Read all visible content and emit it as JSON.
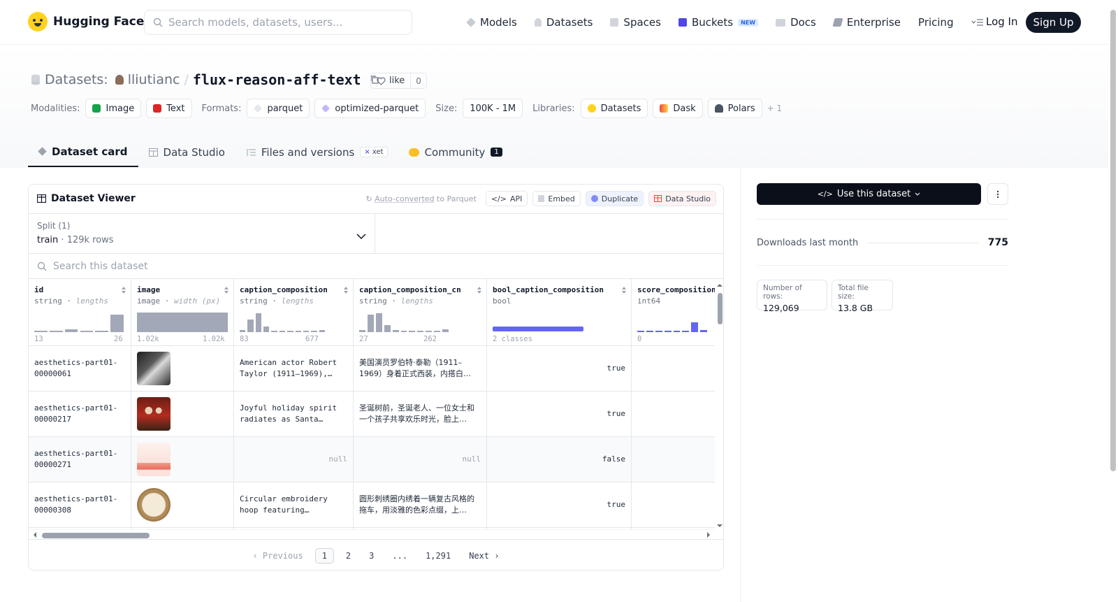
{
  "nav": {
    "brand": "Hugging Face",
    "search_placeholder": "Search models, datasets, users...",
    "links": {
      "models": "Models",
      "datasets": "Datasets",
      "spaces": "Spaces",
      "buckets": "Buckets",
      "buckets_badge": "NEW",
      "docs": "Docs",
      "enterprise": "Enterprise",
      "pricing": "Pricing"
    },
    "login": "Log In",
    "signup": "Sign Up"
  },
  "header": {
    "section": "Datasets:",
    "owner": "lliutianc",
    "separator": "/",
    "name": "flux-reason-aff-text",
    "like_label": "like",
    "like_count": "0",
    "modalities_label": "Modalities:",
    "modalities": [
      "Image",
      "Text"
    ],
    "formats_label": "Formats:",
    "formats": [
      "parquet",
      "optimized-parquet"
    ],
    "size_label": "Size:",
    "size": "100K - 1M",
    "libraries_label": "Libraries:",
    "libraries": [
      "Datasets",
      "Dask",
      "Polars"
    ],
    "libraries_more": "+ 1"
  },
  "tabs": {
    "card": "Dataset card",
    "studio": "Data Studio",
    "files": "Files and versions",
    "files_badge": "xet",
    "community": "Community",
    "community_count": "1"
  },
  "viewer": {
    "title": "Dataset Viewer",
    "auto_converted": "Auto-converted",
    "to_parquet": " to Parquet",
    "api": "API",
    "embed": "Embed",
    "duplicate": "Duplicate",
    "data_studio": "Data Studio",
    "split_label": "Split (1)",
    "split_name": "train",
    "split_dot": "·",
    "split_rows": "129k rows",
    "search_placeholder": "Search this dataset",
    "columns": [
      {
        "name": "id",
        "type": "string",
        "sub": "lengths",
        "min": "13",
        "max": "26",
        "hist": [
          0.05,
          0,
          0.15,
          0,
          0,
          0.9
        ]
      },
      {
        "name": "image",
        "type": "image",
        "sub": "width (px)",
        "min": "1.02k",
        "max": "1.02k",
        "hist": [
          1.0
        ]
      },
      {
        "name": "caption_composition",
        "type": "string",
        "sub": "lengths",
        "min": "83",
        "max": "677",
        "hist": [
          0.1,
          0.65,
          0.95,
          0.3,
          0.08,
          0.05,
          0.04,
          0.03,
          0.03,
          0.03,
          0.1
        ]
      },
      {
        "name": "caption_composition_cn",
        "type": "string",
        "sub": "lengths",
        "min": "27",
        "max": "262",
        "hist": [
          0.1,
          0.9,
          0.95,
          0.35,
          0.12,
          0.06,
          0.05,
          0.04,
          0.03,
          0.03,
          0.15
        ]
      },
      {
        "name": "bool_caption_composition",
        "type": "bool",
        "sub": "",
        "min": "2 classes",
        "max": ""
      },
      {
        "name": "score_composition",
        "type": "int64",
        "sub": "",
        "min": "0",
        "max": "",
        "hist": [
          0.05,
          0.05,
          0.05,
          0.05,
          0.08,
          0,
          0.5,
          0.1
        ]
      }
    ],
    "rows": [
      {
        "id": "aesthetics-part01-00000061",
        "caption": "American actor Robert Taylor (1911–1969),…",
        "caption_cn": "美国演员罗伯特·泰勒（1911–1969）身着正式西装，内搭白…",
        "bool": "true",
        "score": ""
      },
      {
        "id": "aesthetics-part01-00000217",
        "caption": "Joyful holiday spirit radiates as Santa…",
        "caption_cn": "圣诞树前，圣诞老人、一位女士和一个孩子共享欢乐时光，脸上…",
        "bool": "true",
        "score": ""
      },
      {
        "id": "aesthetics-part01-00000271",
        "caption": "null",
        "caption_cn": "null",
        "bool": "false",
        "score": ""
      },
      {
        "id": "aesthetics-part01-00000308",
        "caption": "Circular embroidery hoop featuring…",
        "caption_cn": "圆形刺绣圈内绣着一辆复古风格的拖车，用淡雅的色彩点缀，上…",
        "bool": "true",
        "score": ""
      }
    ],
    "pager": {
      "prev": "Previous",
      "p1": "1",
      "p2": "2",
      "p3": "3",
      "ellipsis": "...",
      "last": "1,291",
      "next": "Next"
    }
  },
  "sidebar": {
    "use_button": "Use this dataset",
    "downloads_label": "Downloads last month",
    "downloads_value": "775",
    "rows_label": "Number of rows:",
    "rows_value": "129,069",
    "size_label": "Total file size:",
    "size_value": "13.8 GB"
  },
  "colors": {
    "accent": "#6366f1",
    "hist": "#a3a8b8",
    "brand": "#ffd21e"
  }
}
